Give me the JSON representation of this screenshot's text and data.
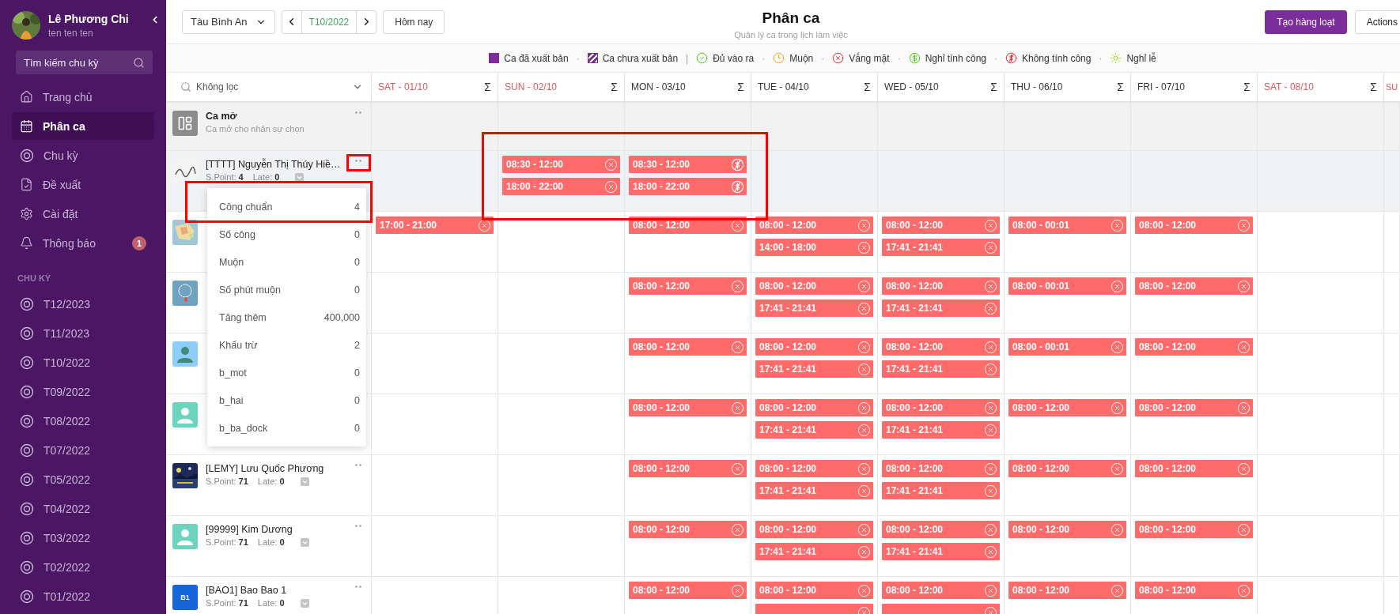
{
  "user": {
    "name": "Lê Phương Chi",
    "subtitle": "ten ten ten"
  },
  "search": {
    "placeholder": "Tìm kiếm chu kỳ"
  },
  "nav": [
    {
      "kind": "home",
      "label": "Trang chủ",
      "selected": false
    },
    {
      "kind": "schedule",
      "label": "Phân ca",
      "selected": true
    },
    {
      "kind": "cycle",
      "label": "Chu kỳ",
      "selected": false
    },
    {
      "kind": "proposal",
      "label": "Đề xuất",
      "selected": false
    },
    {
      "kind": "settings",
      "label": "Cài đặt",
      "selected": false
    },
    {
      "kind": "notifications",
      "label": "Thông báo",
      "selected": false,
      "badge": "1"
    }
  ],
  "cycles_heading": "CHU KỲ",
  "cycles": [
    "T12/2023",
    "T11/2023",
    "T10/2022",
    "T09/2022",
    "T08/2022",
    "T07/2022",
    "T05/2022",
    "T04/2022",
    "T03/2022",
    "T02/2022",
    "T01/2022"
  ],
  "toolbar": {
    "branch": "Tàu Bình An",
    "period": "T10/2022",
    "today": "Hôm nay"
  },
  "page": {
    "title": "Phân ca",
    "subtitle": "Quản lý ca trong lịch làm việc"
  },
  "actions": [
    {
      "kind": "primary",
      "label": "Tạo hàng loạt"
    },
    {
      "kind": "default",
      "label": "Actions"
    }
  ],
  "legend": [
    {
      "kind": "published",
      "label": "Ca đã xuất bản"
    },
    {
      "kind": "separator",
      "label": "·"
    },
    {
      "kind": "unpublished",
      "label": "Ca chưa xuất bản"
    },
    {
      "kind": "divider",
      "label": "|"
    },
    {
      "kind": "present",
      "label": "Đủ vào ra"
    },
    {
      "kind": "separator",
      "label": "·"
    },
    {
      "kind": "late",
      "label": "Muộn"
    },
    {
      "kind": "separator",
      "label": "·"
    },
    {
      "kind": "absent",
      "label": "Vắng mặt"
    },
    {
      "kind": "separator",
      "label": "·"
    },
    {
      "kind": "paid_leave",
      "label": "Nghỉ tính công"
    },
    {
      "kind": "separator",
      "label": "·"
    },
    {
      "kind": "unpaid",
      "label": "Không tính công"
    },
    {
      "kind": "separator",
      "label": "·"
    },
    {
      "kind": "holiday",
      "label": "Nghỉ lễ"
    }
  ],
  "filter": {
    "value": "Không lọc"
  },
  "days": [
    {
      "label": "SAT - 01/10",
      "weekend": true,
      "sum": "Σ"
    },
    {
      "label": "SUN - 02/10",
      "weekend": true,
      "sum": "Σ"
    },
    {
      "label": "MON - 03/10",
      "weekend": false,
      "sum": "Σ"
    },
    {
      "label": "TUE - 04/10",
      "weekend": false,
      "sum": "Σ"
    },
    {
      "label": "WED - 05/10",
      "weekend": false,
      "sum": "Σ"
    },
    {
      "label": "THU - 06/10",
      "weekend": false,
      "sum": "Σ"
    },
    {
      "label": "FRI - 07/10",
      "weekend": false,
      "sum": "Σ"
    },
    {
      "label": "SAT - 08/10",
      "weekend": true,
      "sum": "Σ"
    },
    {
      "label": "SU",
      "weekend": true
    }
  ],
  "open_shift": {
    "title": "Ca mở",
    "subtitle": "Ca mở cho nhân sự chọn"
  },
  "employees": [
    {
      "name": "[TTTT] Nguyễn Thị Thúy Hiề…",
      "avatar": {
        "kind": "picture"
      },
      "highlighted": true,
      "menu": true,
      "stats": {
        "point_label": "S.Point:",
        "point": "4",
        "late_label": "Late:",
        "late": "0"
      },
      "cells": [
        {},
        {
          "shifts": [
            {
              "time": "08:30 - 12:00",
              "kind": "absent"
            },
            {
              "time": "18:00 - 22:00",
              "kind": "absent"
            }
          ]
        },
        {
          "shifts": [
            {
              "time": "08:30 - 12:00",
              "kind": "unpaid"
            },
            {
              "time": "18:00 - 22:00",
              "kind": "unpaid"
            }
          ]
        },
        {},
        {},
        {},
        {},
        {}
      ]
    },
    {
      "avatar": {
        "kind": "picture"
      },
      "highlighted": false,
      "cells": [
        {
          "shifts": [
            {
              "time": "17:00 - 21:00",
              "kind": "absent"
            }
          ]
        },
        {},
        {
          "shifts": [
            {
              "time": "08:00 - 12:00",
              "kind": "absent"
            }
          ]
        },
        {
          "shifts": [
            {
              "time": "08:00 - 12:00",
              "kind": "absent"
            },
            {
              "time": "14:00 - 18:00",
              "kind": "absent"
            }
          ]
        },
        {
          "shifts": [
            {
              "time": "08:00 - 12:00",
              "kind": "absent"
            },
            {
              "time": "17:41 - 21:41",
              "kind": "absent"
            }
          ]
        },
        {
          "shifts": [
            {
              "time": "08:00 - 00:01",
              "kind": "absent"
            }
          ]
        },
        {
          "shifts": [
            {
              "time": "08:00 - 12:00",
              "kind": "absent"
            }
          ]
        },
        {}
      ]
    },
    {
      "avatar": {
        "kind": "picture"
      },
      "highlighted": false,
      "cells": [
        {},
        {},
        {
          "shifts": [
            {
              "time": "08:00 - 12:00",
              "kind": "absent"
            }
          ]
        },
        {
          "shifts": [
            {
              "time": "08:00 - 12:00",
              "kind": "absent"
            },
            {
              "time": "17:41 - 21:41",
              "kind": "absent"
            }
          ]
        },
        {
          "shifts": [
            {
              "time": "08:00 - 12:00",
              "kind": "absent"
            },
            {
              "time": "17:41 - 21:41",
              "kind": "absent"
            }
          ]
        },
        {
          "shifts": [
            {
              "time": "08:00 - 00:01",
              "kind": "absent"
            }
          ]
        },
        {
          "shifts": [
            {
              "time": "08:00 - 12:00",
              "kind": "absent"
            }
          ]
        },
        {}
      ]
    },
    {
      "avatar": {
        "kind": "person",
        "color": "#8ecdf8"
      },
      "highlighted": false,
      "cells": [
        {},
        {},
        {
          "shifts": [
            {
              "time": "08:00 - 12:00",
              "kind": "absent"
            }
          ]
        },
        {
          "shifts": [
            {
              "time": "08:00 - 12:00",
              "kind": "absent"
            },
            {
              "time": "17:41 - 21:41",
              "kind": "absent"
            }
          ]
        },
        {
          "shifts": [
            {
              "time": "08:00 - 12:00",
              "kind": "absent"
            },
            {
              "time": "17:41 - 21:41",
              "kind": "absent"
            }
          ]
        },
        {
          "shifts": [
            {
              "time": "08:00 - 00:01",
              "kind": "absent"
            }
          ]
        },
        {
          "shifts": [
            {
              "time": "08:00 - 12:00",
              "kind": "absent"
            }
          ]
        },
        {}
      ]
    },
    {
      "avatar": {
        "kind": "person",
        "color": "#6cd3bd"
      },
      "highlighted": false,
      "cells": [
        {},
        {},
        {
          "shifts": [
            {
              "time": "08:00 - 12:00",
              "kind": "absent"
            }
          ]
        },
        {
          "shifts": [
            {
              "time": "08:00 - 12:00",
              "kind": "absent"
            },
            {
              "time": "17:41 - 21:41",
              "kind": "absent"
            }
          ]
        },
        {
          "shifts": [
            {
              "time": "08:00 - 12:00",
              "kind": "absent"
            },
            {
              "time": "17:41 - 21:41",
              "kind": "absent"
            }
          ]
        },
        {
          "shifts": [
            {
              "time": "08:00 - 12:00",
              "kind": "absent"
            }
          ]
        },
        {
          "shifts": [
            {
              "time": "08:00 - 12:00",
              "kind": "absent"
            }
          ]
        },
        {}
      ]
    },
    {
      "name": "[LEMY] Lưu Quốc Phương",
      "avatar": {
        "kind": "picture"
      },
      "highlighted": false,
      "menu": true,
      "stats": {
        "point_label": "S.Point:",
        "point": "71",
        "late_label": "Late:",
        "late": "0"
      },
      "cells": [
        {},
        {},
        {
          "shifts": [
            {
              "time": "08:00 - 12:00",
              "kind": "absent"
            }
          ]
        },
        {
          "shifts": [
            {
              "time": "08:00 - 12:00",
              "kind": "absent"
            },
            {
              "time": "17:41 - 21:41",
              "kind": "absent"
            }
          ]
        },
        {
          "shifts": [
            {
              "time": "08:00 - 12:00",
              "kind": "absent"
            },
            {
              "time": "17:41 - 21:41",
              "kind": "absent"
            }
          ]
        },
        {
          "shifts": [
            {
              "time": "08:00 - 12:00",
              "kind": "absent"
            }
          ]
        },
        {
          "shifts": [
            {
              "time": "08:00 - 12:00",
              "kind": "absent"
            }
          ]
        },
        {}
      ]
    },
    {
      "name": "[99999] Kim Dương",
      "avatar": {
        "kind": "person",
        "color": "#6cd3bd"
      },
      "highlighted": false,
      "menu": true,
      "stats": {
        "point_label": "S.Point:",
        "point": "71",
        "late_label": "Late:",
        "late": "0"
      },
      "cells": [
        {},
        {},
        {
          "shifts": [
            {
              "time": "08:00 - 12:00",
              "kind": "absent"
            }
          ]
        },
        {
          "shifts": [
            {
              "time": "08:00 - 12:00",
              "kind": "absent"
            },
            {
              "time": "17:41 - 21:41",
              "kind": "absent"
            }
          ]
        },
        {
          "shifts": [
            {
              "time": "08:00 - 12:00",
              "kind": "absent"
            },
            {
              "time": "17:41 - 21:41",
              "kind": "absent"
            }
          ]
        },
        {
          "shifts": [
            {
              "time": "08:00 - 12:00",
              "kind": "absent"
            }
          ]
        },
        {
          "shifts": [
            {
              "time": "08:00 - 12:00",
              "kind": "absent"
            }
          ]
        },
        {}
      ]
    },
    {
      "name": "[BAO1] Bao Bao 1",
      "avatar": {
        "kind": "initials",
        "text": "B1",
        "color": "#1565d8"
      },
      "highlighted": false,
      "menu": true,
      "stats": {
        "point_label": "S.Point:",
        "point": "71",
        "late_label": "Late:",
        "late": "0"
      },
      "cells": [
        {},
        {},
        {
          "shifts": [
            {
              "time": "08:00 - 12:00",
              "kind": "absent"
            }
          ]
        },
        {
          "shifts": [
            {
              "time": "08:00 - 12:00",
              "kind": "absent"
            },
            {
              "kind": "absent"
            }
          ]
        },
        {
          "shifts": [
            {
              "time": "08:00 - 12:00",
              "kind": "absent"
            },
            {
              "kind": "absent"
            }
          ]
        },
        {
          "shifts": [
            {
              "time": "08:00 - 12:00",
              "kind": "absent"
            }
          ]
        },
        {
          "shifts": [
            {
              "time": "08:00 - 12:00",
              "kind": "absent"
            }
          ]
        },
        {}
      ]
    }
  ],
  "popup": [
    {
      "label": "Công chuẩn",
      "value": "4"
    },
    {
      "label": "Số công",
      "value": "0"
    },
    {
      "label": "Muộn",
      "value": "0"
    },
    {
      "label": "Số phút muộn",
      "value": "0"
    },
    {
      "label": "Tăng thêm",
      "value": "400,000"
    },
    {
      "label": "Khấu trừ",
      "value": "2"
    },
    {
      "label": "b_mot",
      "value": "0"
    },
    {
      "label": "b_hai",
      "value": "0"
    },
    {
      "label": "b_ba_dock",
      "value": "0"
    }
  ]
}
